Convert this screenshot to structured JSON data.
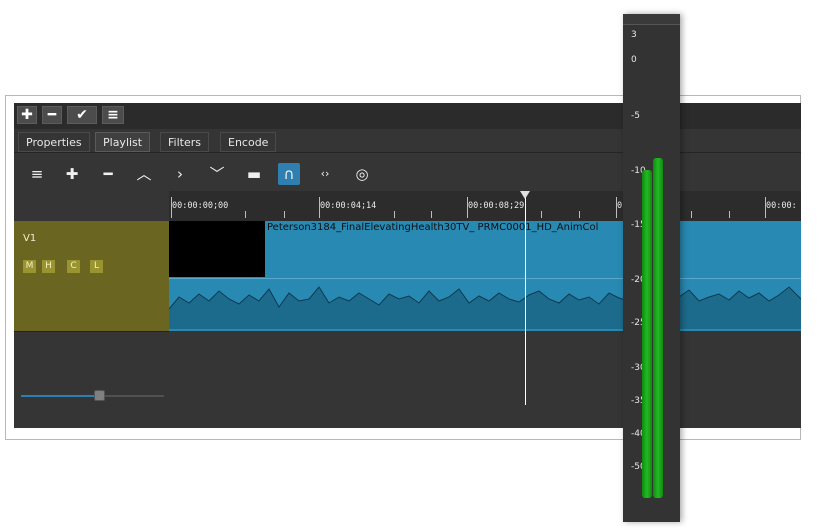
{
  "toolbar_top": {
    "buttons": [
      {
        "icon": "plus-icon",
        "glyph": "✚"
      },
      {
        "icon": "minus-icon",
        "glyph": "━"
      },
      {
        "icon": "check-icon",
        "glyph": "✔"
      },
      {
        "icon": "menu-icon",
        "glyph": "≡"
      }
    ]
  },
  "tabs": [
    "Properties",
    "Playlist",
    "Filters",
    "Encode"
  ],
  "active_tab": "Playlist",
  "timeline_toolbar": {
    "icons": [
      {
        "name": "menu-icon",
        "glyph": "≡"
      },
      {
        "name": "append-icon",
        "glyph": "✚"
      },
      {
        "name": "remove-icon",
        "glyph": "━"
      },
      {
        "name": "lift-icon",
        "glyph": "︿"
      },
      {
        "name": "overwrite-icon",
        "glyph": "›"
      },
      {
        "name": "split-icon",
        "glyph": "﹀"
      },
      {
        "name": "ripple-icon",
        "glyph": "▬"
      },
      {
        "name": "snap-icon",
        "glyph": "∩"
      },
      {
        "name": "scrub-icon",
        "glyph": "‹›"
      },
      {
        "name": "ripple-all-icon",
        "glyph": "◎"
      }
    ]
  },
  "ruler": {
    "labels": [
      "00:00:00;00",
      "00:00:04;14",
      "00:00:08;29",
      "0",
      "00:00:"
    ]
  },
  "track": {
    "name": "V1",
    "buttons": [
      "M",
      "H",
      "C",
      "L"
    ],
    "clip_title": "Peterson3184_FinalElevatingHealth30TV_ PRMC0001_HD_AnimCol"
  },
  "zoom_slider": {
    "value": 0.55
  },
  "meter": {
    "labels": [
      "3",
      "0",
      "-5",
      "-10",
      "-15",
      "-20",
      "-25",
      "-30",
      "-35",
      "-40",
      "-50"
    ],
    "left_level": 0.82,
    "right_level": 0.85,
    "bar_color": "#22bb22"
  },
  "colors": {
    "accent": "#2f7fb0",
    "clip": "#2889b3",
    "track_head": "#6a6520"
  }
}
